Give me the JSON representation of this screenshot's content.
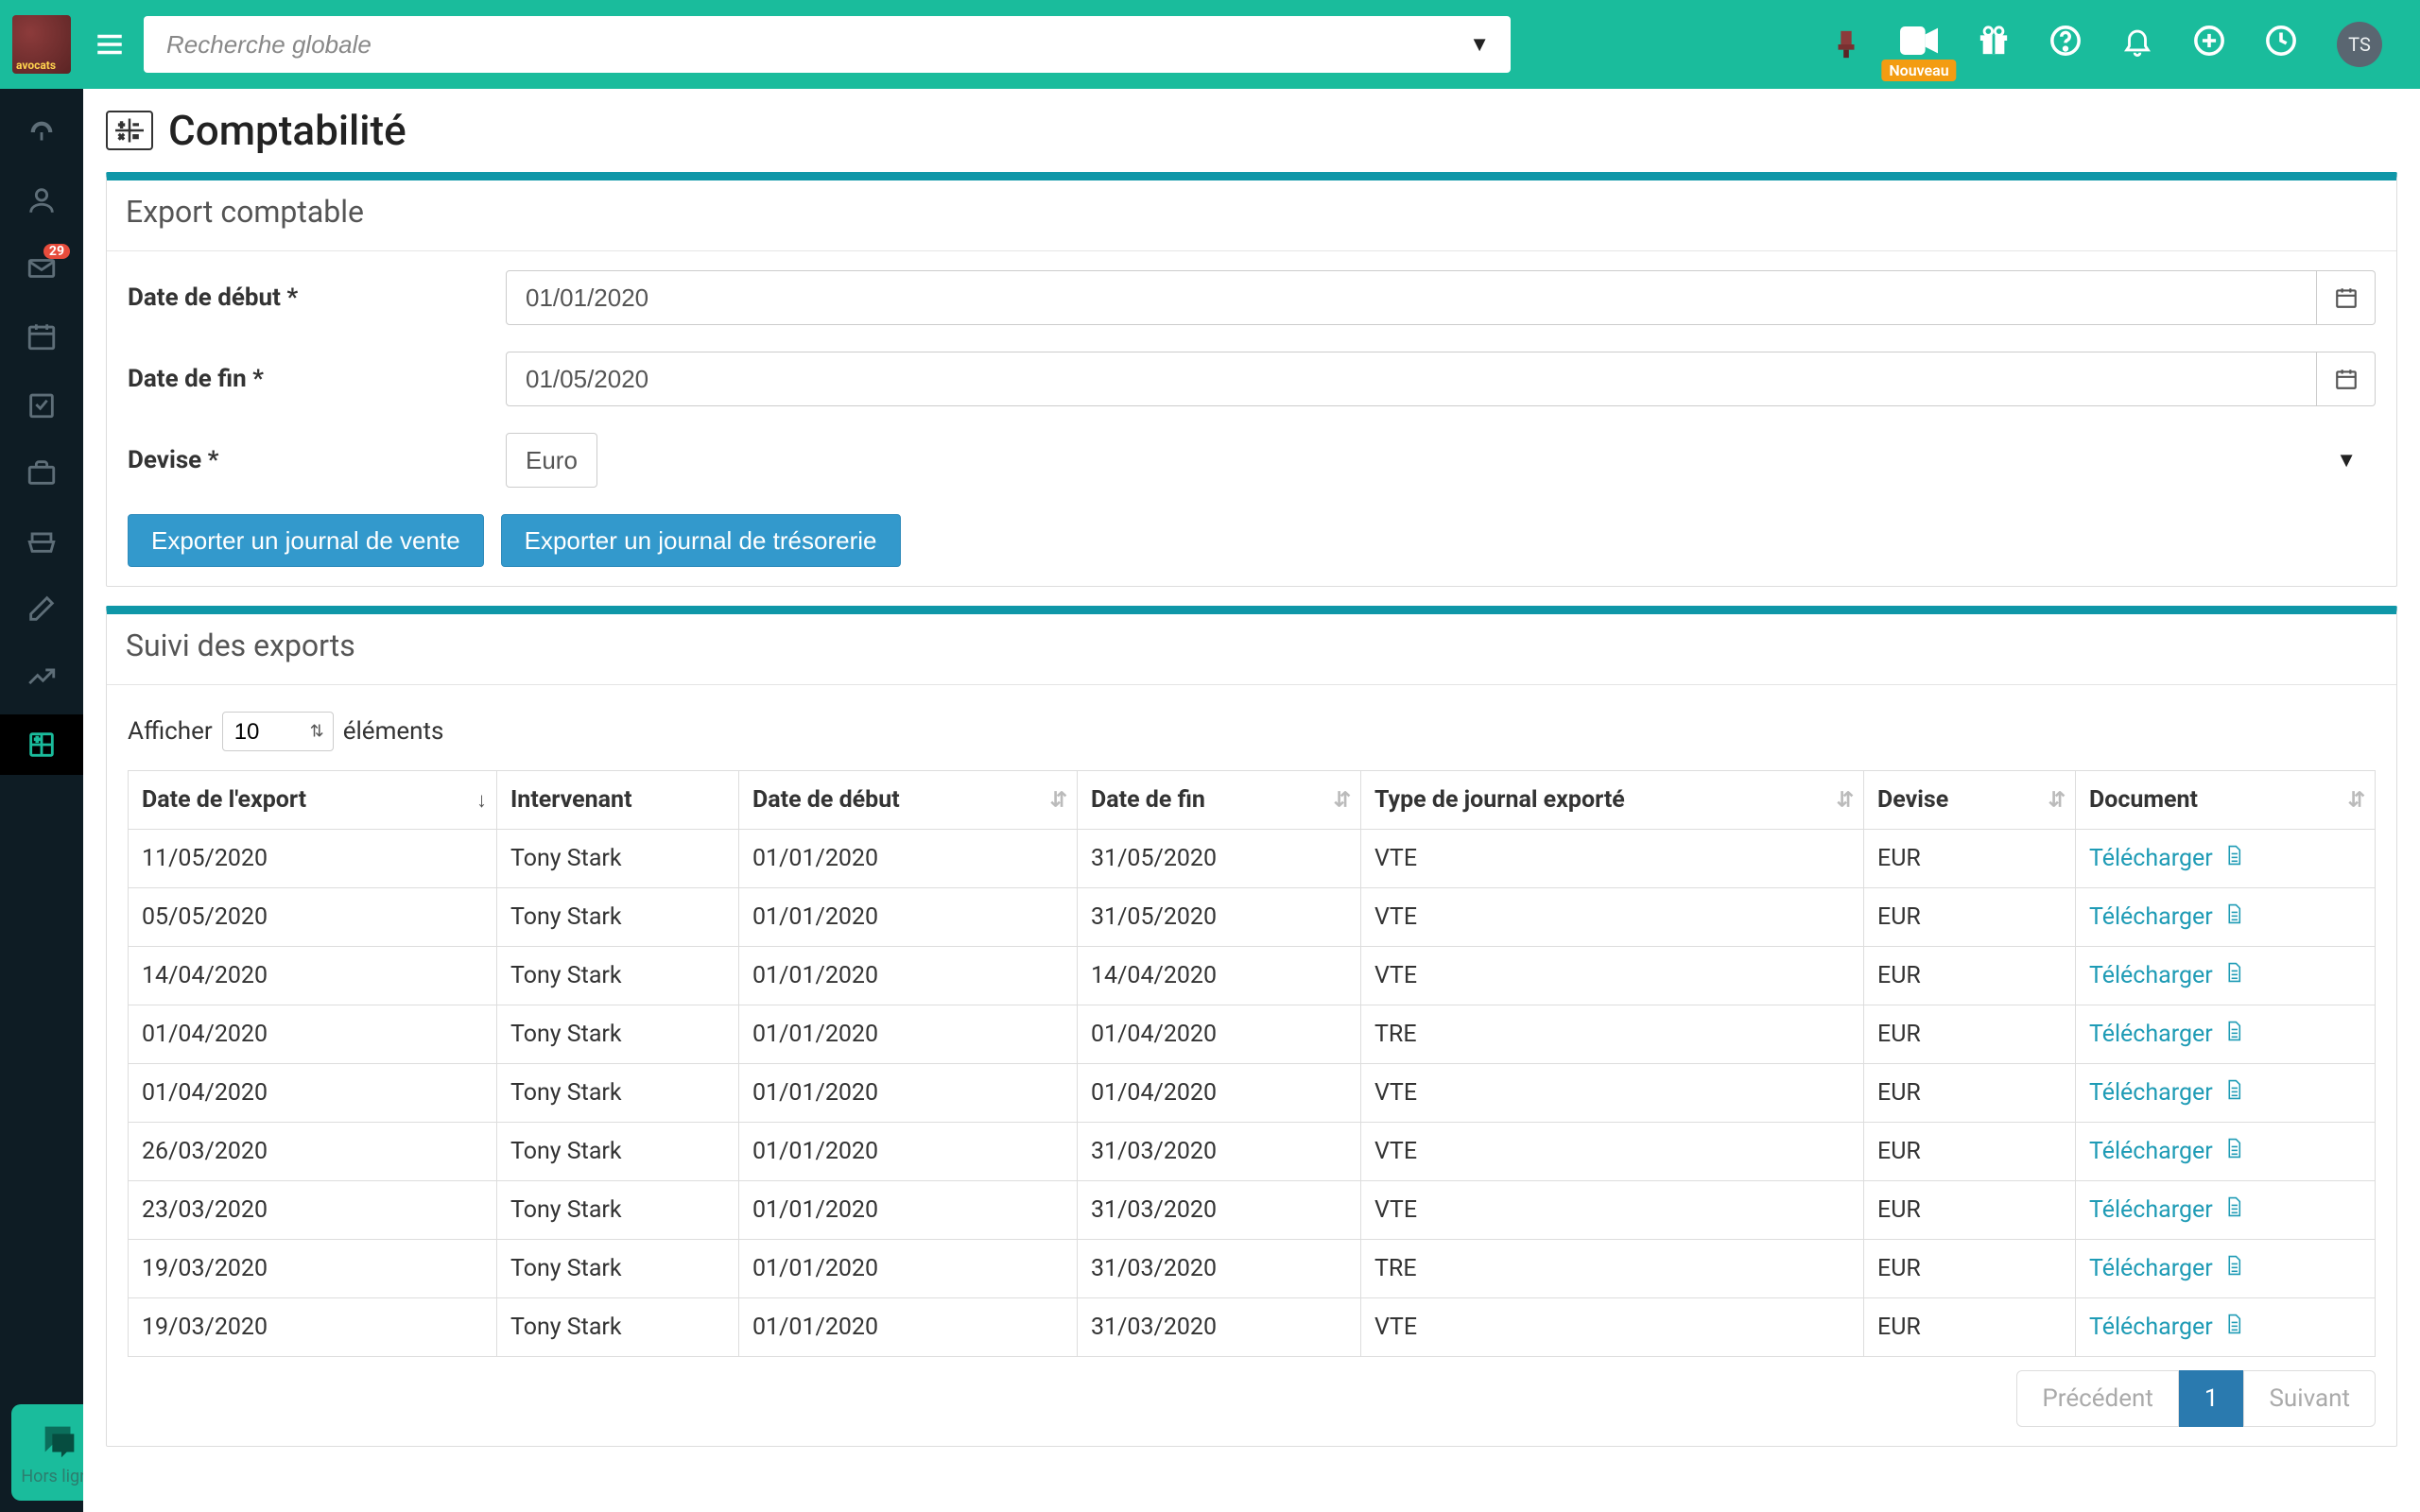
{
  "header": {
    "search_placeholder": "Recherche globale",
    "nouveau_badge": "Nouveau",
    "avatar_initials": "TS"
  },
  "sidebar": {
    "mail_badge": "29"
  },
  "chat": {
    "status": "Hors ligne"
  },
  "page": {
    "title": "Comptabilité"
  },
  "export_panel": {
    "title": "Export comptable",
    "start_label": "Date de début *",
    "start_value": "01/01/2020",
    "end_label": "Date de fin *",
    "end_value": "01/05/2020",
    "currency_label": "Devise *",
    "currency_value": "Euro",
    "btn_sales": "Exporter un journal de vente",
    "btn_treasury": "Exporter un journal de trésorerie"
  },
  "history_panel": {
    "title": "Suivi des exports",
    "show_label": "Afficher",
    "elements_label": "éléments",
    "page_length": "10",
    "columns": {
      "export_date": "Date de l'export",
      "intervenant": "Intervenant",
      "start": "Date de début",
      "end": "Date de fin",
      "type": "Type de journal exporté",
      "currency": "Devise",
      "document": "Document"
    },
    "download_label": "Télécharger",
    "rows": [
      {
        "export_date": "11/05/2020",
        "intervenant": "Tony Stark",
        "start": "01/01/2020",
        "end": "31/05/2020",
        "type": "VTE",
        "currency": "EUR"
      },
      {
        "export_date": "05/05/2020",
        "intervenant": "Tony Stark",
        "start": "01/01/2020",
        "end": "31/05/2020",
        "type": "VTE",
        "currency": "EUR"
      },
      {
        "export_date": "14/04/2020",
        "intervenant": "Tony Stark",
        "start": "01/01/2020",
        "end": "14/04/2020",
        "type": "VTE",
        "currency": "EUR"
      },
      {
        "export_date": "01/04/2020",
        "intervenant": "Tony Stark",
        "start": "01/01/2020",
        "end": "01/04/2020",
        "type": "TRE",
        "currency": "EUR"
      },
      {
        "export_date": "01/04/2020",
        "intervenant": "Tony Stark",
        "start": "01/01/2020",
        "end": "01/04/2020",
        "type": "VTE",
        "currency": "EUR"
      },
      {
        "export_date": "26/03/2020",
        "intervenant": "Tony Stark",
        "start": "01/01/2020",
        "end": "31/03/2020",
        "type": "VTE",
        "currency": "EUR"
      },
      {
        "export_date": "23/03/2020",
        "intervenant": "Tony Stark",
        "start": "01/01/2020",
        "end": "31/03/2020",
        "type": "VTE",
        "currency": "EUR"
      },
      {
        "export_date": "19/03/2020",
        "intervenant": "Tony Stark",
        "start": "01/01/2020",
        "end": "31/03/2020",
        "type": "TRE",
        "currency": "EUR"
      },
      {
        "export_date": "19/03/2020",
        "intervenant": "Tony Stark",
        "start": "01/01/2020",
        "end": "31/03/2020",
        "type": "VTE",
        "currency": "EUR"
      }
    ]
  },
  "pagination": {
    "prev": "Précédent",
    "page": "1",
    "next": "Suivant"
  }
}
